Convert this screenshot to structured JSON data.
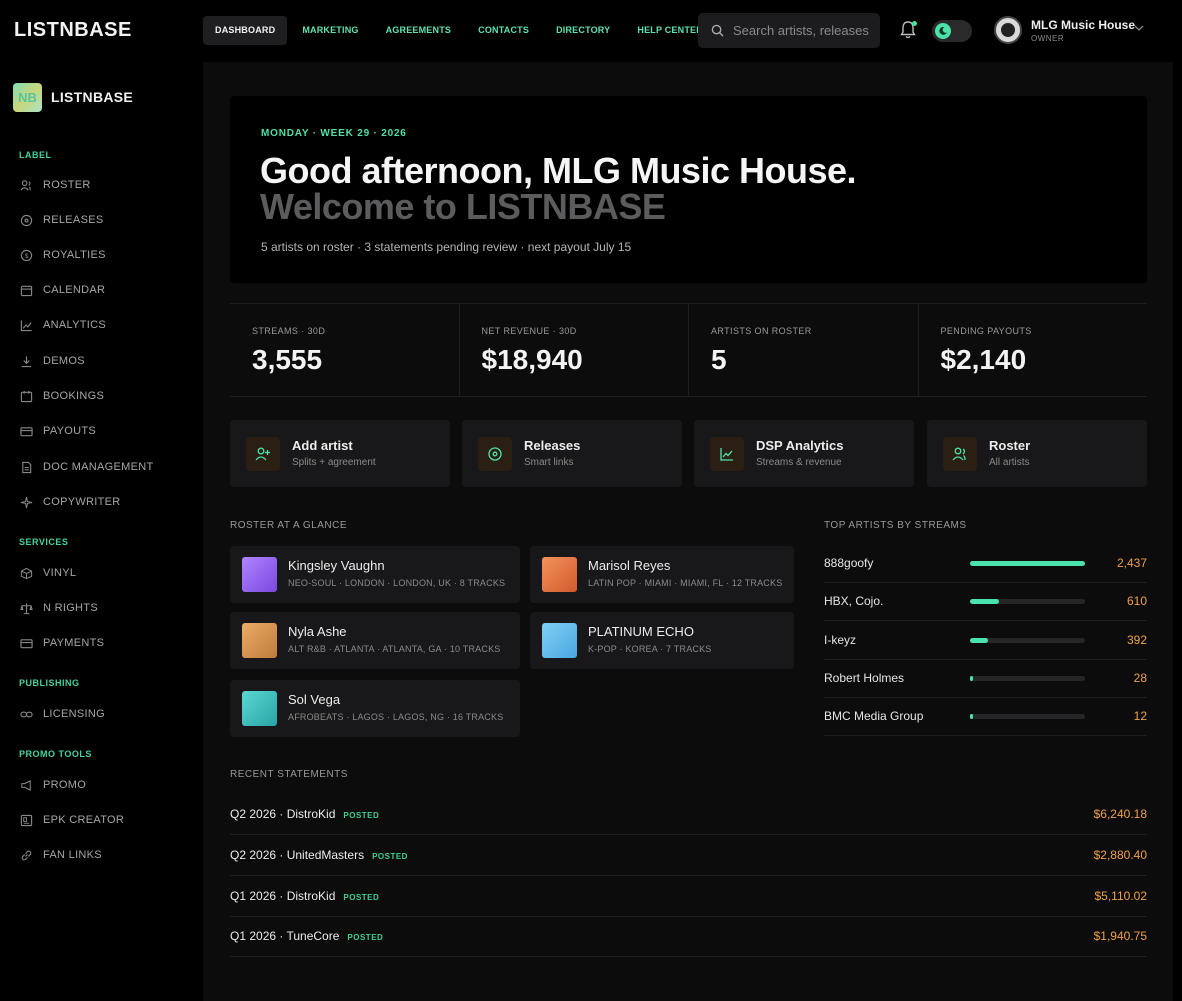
{
  "app": {
    "brand": "LISTNBASE",
    "logo_glyph": "NB"
  },
  "topnav": {
    "items": [
      {
        "label": "DASHBOARD",
        "active": true
      },
      {
        "label": "MARKETING"
      },
      {
        "label": "AGREEMENTS"
      },
      {
        "label": "CONTACTS"
      },
      {
        "label": "DIRECTORY"
      },
      {
        "label": "HELP CENTER"
      }
    ],
    "search_placeholder": "Search artists, releases",
    "user": {
      "name": "MLG Music House",
      "role": "OWNER"
    }
  },
  "sidebar": {
    "brand": "LISTNBASE",
    "sections": [
      {
        "title": "LABEL",
        "items": [
          "ROSTER",
          "RELEASES",
          "ROYALTIES",
          "CALENDAR",
          "ANALYTICS",
          "DEMOS",
          "BOOKINGS",
          "PAYOUTS",
          "DOC MANAGEMENT",
          "COPYWRITER"
        ]
      },
      {
        "title": "SERVICES",
        "items": [
          "VINYL",
          "N RIGHTS",
          "PAYMENTS"
        ]
      },
      {
        "title": "PUBLISHING",
        "items": [
          "LICENSING"
        ]
      },
      {
        "title": "PROMO TOOLS",
        "items": [
          "PROMO",
          "EPK CREATOR",
          "FAN LINKS"
        ]
      }
    ]
  },
  "hero": {
    "kicker": "MONDAY · WEEK 29 · 2026",
    "title1": "Good afternoon, MLG Music House.",
    "title2": "Welcome to LISTNBASE",
    "subtitle": "5 artists on roster · 3 statements pending review · next payout July 15"
  },
  "stats": [
    {
      "label": "STREAMS · 30D",
      "value": "3,555"
    },
    {
      "label": "NET REVENUE · 30D",
      "value": "$18,940"
    },
    {
      "label": "ARTISTS ON ROSTER",
      "value": "5"
    },
    {
      "label": "PENDING PAYOUTS",
      "value": "$2,140"
    }
  ],
  "quick_actions": [
    {
      "title": "Add artist",
      "subtitle": "Splits + agreement",
      "icon": "user-plus-icon"
    },
    {
      "title": "Releases",
      "subtitle": "Smart links",
      "icon": "disc-icon"
    },
    {
      "title": "DSP Analytics",
      "subtitle": "Streams & revenue",
      "icon": "chart-icon"
    },
    {
      "title": "Roster",
      "subtitle": "All artists",
      "icon": "users-icon"
    }
  ],
  "roster": {
    "title": "ROSTER AT A GLANCE",
    "artists": [
      {
        "name": "Kingsley Vaughn",
        "meta": "NEO-SOUL · LONDON · LONDON, UK · 8 TRACKS",
        "color": "#9b6bf0"
      },
      {
        "name": "Marisol Reyes",
        "meta": "LATIN POP · MIAMI · MIAMI, FL · 12 TRACKS",
        "color": "#e8733f"
      },
      {
        "name": "Nyla Ashe",
        "meta": "ALT R&B · ATLANTA · ATLANTA, GA · 10 TRACKS",
        "color": "#d9954e"
      },
      {
        "name": "PLATINUM ECHO",
        "meta": "K-POP · KOREA · 7 TRACKS",
        "color": "#5fb9ec"
      },
      {
        "name": "Sol Vega",
        "meta": "AFROBEATS · LAGOS · LAGOS, NG · 16 TRACKS",
        "color": "#3cc1c0"
      }
    ]
  },
  "top_artists": {
    "title": "TOP ARTISTS BY STREAMS",
    "rows": [
      {
        "name": "888goofy",
        "value": "2,437",
        "streams": 2437
      },
      {
        "name": "HBX, Cojo.",
        "value": "610",
        "streams": 610
      },
      {
        "name": "I-keyz",
        "value": "392",
        "streams": 392
      },
      {
        "name": "Robert Holmes",
        "value": "28",
        "streams": 28
      },
      {
        "name": "BMC Media Group",
        "value": "12",
        "streams": 12
      }
    ]
  },
  "statements": {
    "title": "RECENT STATEMENTS",
    "rows": [
      {
        "name": "Q2 2026 · DistroKid",
        "status": "POSTED",
        "amount": "$6,240.18"
      },
      {
        "name": "Q2 2026 · UnitedMasters",
        "status": "POSTED",
        "amount": "$2,880.40"
      },
      {
        "name": "Q1 2026 · DistroKid",
        "status": "POSTED",
        "amount": "$5,110.02"
      },
      {
        "name": "Q1 2026 · TuneCore",
        "status": "POSTED",
        "amount": "$1,940.75"
      }
    ]
  }
}
